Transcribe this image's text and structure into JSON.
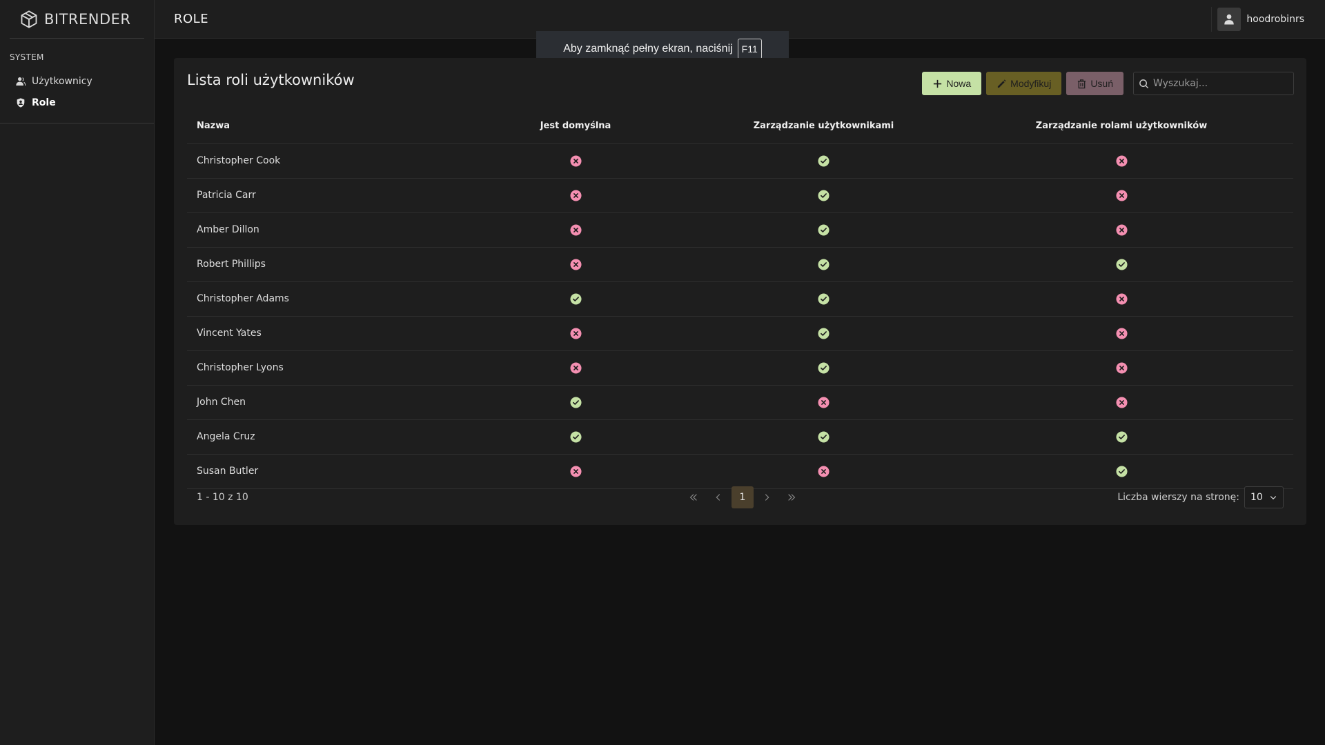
{
  "sidebar": {
    "brand": "BITRENDER",
    "section_label": "SYSTEM",
    "items": [
      {
        "label": "Użytkownicy",
        "icon": "users-icon",
        "active": false
      },
      {
        "label": "Role",
        "icon": "shield-icon",
        "active": true
      }
    ]
  },
  "header": {
    "title": "ROLE",
    "username": "hoodrobinrs"
  },
  "fullscreen_notice": {
    "text": "Aby zamknąć pełny ekran, naciśnij",
    "key": "F11"
  },
  "card": {
    "title": "Lista roli użytkowników",
    "toolbar": {
      "new_label": "Nowa",
      "edit_label": "Modyfikuj",
      "delete_label": "Usuń",
      "search_placeholder": "Wyszukaj..."
    },
    "columns": [
      "Nazwa",
      "Jest domyślna",
      "Zarządzanie użytkownikami",
      "Zarządzanie rolami użytkowników"
    ],
    "rows": [
      {
        "name": "Christopher Cook",
        "is_default": false,
        "manage_users": true,
        "manage_roles": false
      },
      {
        "name": "Patricia Carr",
        "is_default": false,
        "manage_users": true,
        "manage_roles": false
      },
      {
        "name": "Amber Dillon",
        "is_default": false,
        "manage_users": true,
        "manage_roles": false
      },
      {
        "name": "Robert Phillips",
        "is_default": false,
        "manage_users": true,
        "manage_roles": true
      },
      {
        "name": "Christopher Adams",
        "is_default": true,
        "manage_users": true,
        "manage_roles": false
      },
      {
        "name": "Vincent Yates",
        "is_default": false,
        "manage_users": true,
        "manage_roles": false
      },
      {
        "name": "Christopher Lyons",
        "is_default": false,
        "manage_users": true,
        "manage_roles": false
      },
      {
        "name": "John Chen",
        "is_default": true,
        "manage_users": false,
        "manage_roles": false
      },
      {
        "name": "Angela Cruz",
        "is_default": true,
        "manage_users": true,
        "manage_roles": true
      },
      {
        "name": "Susan Butler",
        "is_default": false,
        "manage_users": false,
        "manage_roles": true
      }
    ],
    "paginator": {
      "report": "1 - 10 z 10",
      "current_page": "1",
      "rows_label": "Liczba wierszy na stronę:",
      "rows_value": "10"
    }
  },
  "colors": {
    "true_icon": "#c5e1a5",
    "false_icon": "#f48fb1"
  }
}
